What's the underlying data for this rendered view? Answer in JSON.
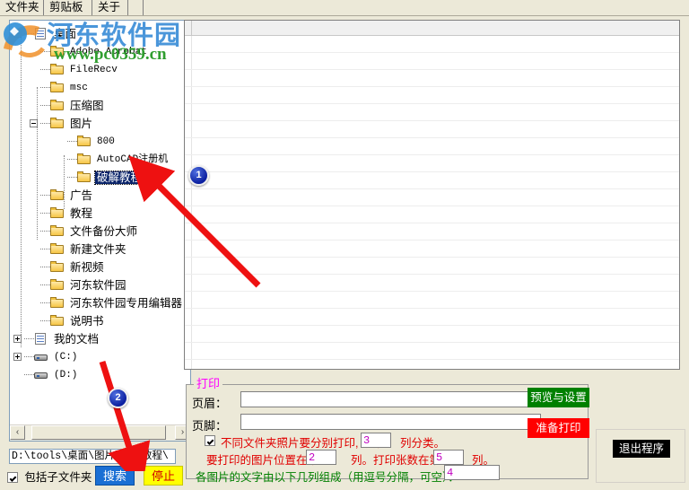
{
  "tabs": [
    {
      "label": "文件夹",
      "selected": true
    },
    {
      "label": "剪贴板",
      "selected": false
    },
    {
      "label": "关于",
      "selected": false
    }
  ],
  "watermark": {
    "brand": "河东软件园",
    "url": "www.pc0359.cn",
    "brand_color": "#3d8fd8",
    "url_color": "#2f9e2f"
  },
  "tree": {
    "nodes": [
      {
        "label": "桌面",
        "indent": 0,
        "icon": "doc-icon",
        "expander": "minus",
        "selected": false,
        "ascii": false
      },
      {
        "label": "Adobe Acrobat",
        "indent": 1,
        "icon": "folder-icon",
        "expander": "none",
        "selected": false,
        "ascii": true
      },
      {
        "label": "FileRecv",
        "indent": 1,
        "icon": "folder-icon",
        "expander": "none",
        "selected": false,
        "ascii": true
      },
      {
        "label": "msc",
        "indent": 1,
        "icon": "folder-icon",
        "expander": "none",
        "selected": false,
        "ascii": true
      },
      {
        "label": "压缩图",
        "indent": 1,
        "icon": "folder-icon",
        "expander": "none",
        "selected": false,
        "ascii": false
      },
      {
        "label": "图片",
        "indent": 1,
        "icon": "folder-icon",
        "expander": "minus",
        "selected": false,
        "ascii": false
      },
      {
        "label": "800",
        "indent": 2,
        "icon": "folder-icon",
        "expander": "none",
        "selected": false,
        "ascii": true
      },
      {
        "label": "AutoCAD注册机",
        "indent": 2,
        "icon": "folder-icon",
        "expander": "none",
        "selected": false,
        "ascii": true
      },
      {
        "label": "破解教程",
        "indent": 2,
        "icon": "folder-icon",
        "expander": "none",
        "selected": true,
        "ascii": false
      },
      {
        "label": "广告",
        "indent": 1,
        "icon": "folder-icon",
        "expander": "none",
        "selected": false,
        "ascii": false
      },
      {
        "label": "教程",
        "indent": 1,
        "icon": "folder-icon",
        "expander": "none",
        "selected": false,
        "ascii": false
      },
      {
        "label": "文件备份大师",
        "indent": 1,
        "icon": "folder-icon",
        "expander": "none",
        "selected": false,
        "ascii": false
      },
      {
        "label": "新建文件夹",
        "indent": 1,
        "icon": "folder-icon",
        "expander": "none",
        "selected": false,
        "ascii": false
      },
      {
        "label": "新视频",
        "indent": 1,
        "icon": "folder-icon",
        "expander": "none",
        "selected": false,
        "ascii": false
      },
      {
        "label": "河东软件园",
        "indent": 1,
        "icon": "folder-icon",
        "expander": "none",
        "selected": false,
        "ascii": false
      },
      {
        "label": "河东软件园专用编辑器",
        "indent": 1,
        "icon": "folder-icon",
        "expander": "none",
        "selected": false,
        "ascii": false
      },
      {
        "label": "说明书",
        "indent": 1,
        "icon": "folder-icon",
        "expander": "none",
        "selected": false,
        "ascii": false
      },
      {
        "label": "我的文档",
        "indent": 0,
        "icon": "doc-icon",
        "expander": "plus",
        "selected": false,
        "ascii": false
      },
      {
        "label": "(C:)",
        "indent": 0,
        "icon": "drive-icon",
        "expander": "plus",
        "selected": false,
        "ascii": true
      },
      {
        "label": "(D:)",
        "indent": 0,
        "icon": "drive-icon",
        "expander": "none",
        "selected": false,
        "ascii": true
      }
    ],
    "hscroll": {
      "left_arrow": "‹",
      "right_arrow": "›"
    }
  },
  "path": {
    "value": "D:\\tools\\桌面\\图片\\破解教程\\",
    "placeholder": ""
  },
  "search_bar": {
    "include_subfolders_label": "包括子文件夹",
    "include_subfolders_checked": true,
    "search_label": "搜索",
    "stop_label": "停止",
    "search_bg": "#1a6fd4",
    "stop_bg": "#ffff00",
    "stop_fg": "#d00000"
  },
  "print_group": {
    "title": "打印",
    "title_color": "#ff00ff",
    "header_label": "页眉：",
    "header_value": "",
    "footer_label": "页脚：",
    "footer_value": "",
    "separate_print_checked": true,
    "separate_print_text_a": "不同文件夹照片要分别打印, 以第",
    "separate_print_col": "3",
    "separate_print_text_b": "列分类。",
    "image_pos_text_a": "要打印的图片位置在第",
    "image_pos_col": "2",
    "image_pos_text_b": "列。打印张数在第",
    "copies_col": "5",
    "image_pos_text_c": "列。",
    "caption_text": "各图片的文字由以下几列组成（用逗号分隔，可空）：",
    "caption_cols": "4",
    "caption_color": "#008000",
    "row_color": "#e00000"
  },
  "buttons": {
    "preview_label": "预览与设置",
    "preview_bg": "#008000",
    "prepare_print_label": "准备打印",
    "prepare_print_bg": "#ff0000",
    "exit_label": "退出程序",
    "exit_bg": "#000000"
  },
  "annotations": [
    {
      "number": "1"
    },
    {
      "number": "2"
    }
  ]
}
